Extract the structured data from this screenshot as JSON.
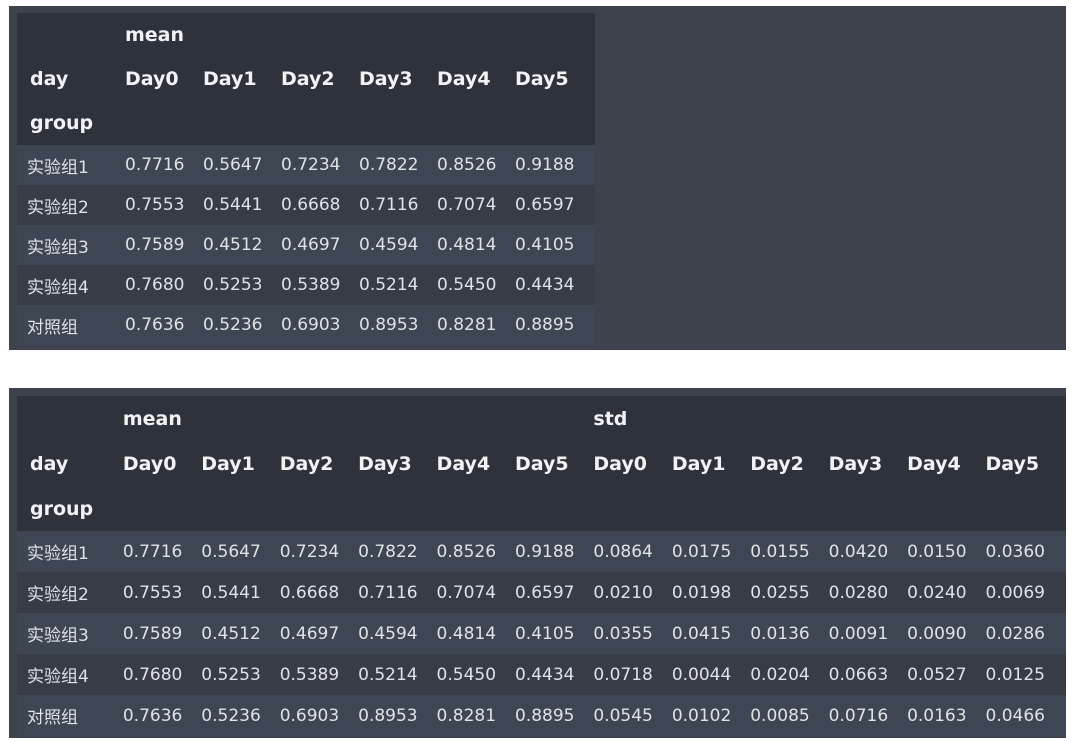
{
  "table1": {
    "top_header": {
      "mean": "mean"
    },
    "index_name": "day",
    "row_index_name": "group",
    "columns": [
      "Day0",
      "Day1",
      "Day2",
      "Day3",
      "Day4",
      "Day5"
    ],
    "rows": [
      {
        "label": "实验组1",
        "values": [
          "0.7716",
          "0.5647",
          "0.7234",
          "0.7822",
          "0.8526",
          "0.9188"
        ]
      },
      {
        "label": "实验组2",
        "values": [
          "0.7553",
          "0.5441",
          "0.6668",
          "0.7116",
          "0.7074",
          "0.6597"
        ]
      },
      {
        "label": "实验组3",
        "values": [
          "0.7589",
          "0.4512",
          "0.4697",
          "0.4594",
          "0.4814",
          "0.4105"
        ]
      },
      {
        "label": "实验组4",
        "values": [
          "0.7680",
          "0.5253",
          "0.5389",
          "0.5214",
          "0.5450",
          "0.4434"
        ]
      },
      {
        "label": "对照组",
        "values": [
          "0.7636",
          "0.5236",
          "0.6903",
          "0.8953",
          "0.8281",
          "0.8895"
        ]
      }
    ]
  },
  "table2": {
    "top_header": {
      "mean": "mean",
      "std": "std"
    },
    "index_name": "day",
    "row_index_name": "group",
    "columns": [
      "Day0",
      "Day1",
      "Day2",
      "Day3",
      "Day4",
      "Day5",
      "Day0",
      "Day1",
      "Day2",
      "Day3",
      "Day4",
      "Day5"
    ],
    "rows": [
      {
        "label": "实验组1",
        "values": [
          "0.7716",
          "0.5647",
          "0.7234",
          "0.7822",
          "0.8526",
          "0.9188",
          "0.0864",
          "0.0175",
          "0.0155",
          "0.0420",
          "0.0150",
          "0.0360"
        ]
      },
      {
        "label": "实验组2",
        "values": [
          "0.7553",
          "0.5441",
          "0.6668",
          "0.7116",
          "0.7074",
          "0.6597",
          "0.0210",
          "0.0198",
          "0.0255",
          "0.0280",
          "0.0240",
          "0.0069"
        ]
      },
      {
        "label": "实验组3",
        "values": [
          "0.7589",
          "0.4512",
          "0.4697",
          "0.4594",
          "0.4814",
          "0.4105",
          "0.0355",
          "0.0415",
          "0.0136",
          "0.0091",
          "0.0090",
          "0.0286"
        ]
      },
      {
        "label": "实验组4",
        "values": [
          "0.7680",
          "0.5253",
          "0.5389",
          "0.5214",
          "0.5450",
          "0.4434",
          "0.0718",
          "0.0044",
          "0.0204",
          "0.0663",
          "0.0527",
          "0.0125"
        ]
      },
      {
        "label": "对照组",
        "values": [
          "0.7636",
          "0.5236",
          "0.6903",
          "0.8953",
          "0.8281",
          "0.8895",
          "0.0545",
          "0.0102",
          "0.0085",
          "0.0716",
          "0.0163",
          "0.0466"
        ]
      }
    ]
  }
}
